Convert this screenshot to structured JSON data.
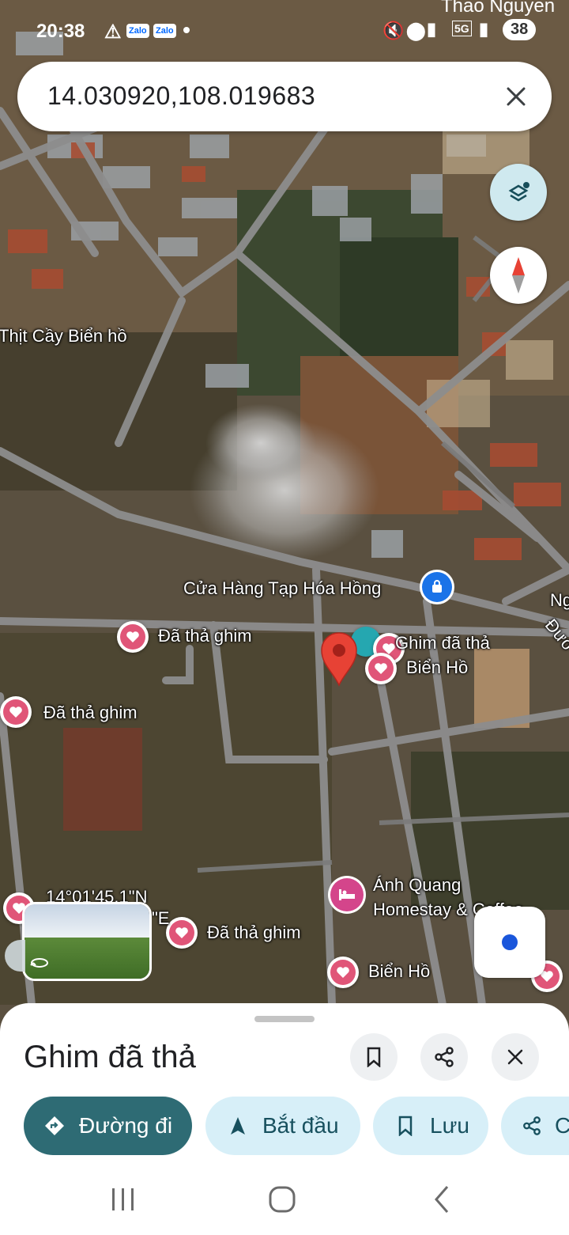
{
  "status_bar": {
    "time": "20:38",
    "app_badge_1": "Zalo",
    "app_badge_2": "Zalo",
    "network": "5G",
    "battery": "38",
    "overlay_name": "Thao Nguyen"
  },
  "search": {
    "query": "14.030920,108.019683"
  },
  "map": {
    "labels": {
      "thit_cay": "Thịt Cầy Biển hồ",
      "tap_hoa": "Cửa Hàng Tạp Hóa Hồng",
      "pin_1": "Đã thả ghim",
      "pin_2": "Đã thả ghim",
      "pin_3": "Đã thả ghim",
      "ghim_line1": "Ghim đã thả",
      "ghim_line2": "Biển Hồ",
      "anh_quang_line1": "Ánh Quang",
      "anh_quang_line2": "Homestay & Coffee",
      "bien_ho": "Biển Hồ",
      "coords_partial_1": "14°01'45.1\"N",
      "coords_partial_2": "\"E",
      "edge_1": "Ng",
      "edge_2": "Đườ"
    },
    "colors": {
      "pin": "#e74235",
      "heart": "#e05578",
      "location_dot": "#1a56db"
    }
  },
  "sheet": {
    "title": "Ghim đã thả",
    "chips": {
      "directions": "Đường đi",
      "start": "Bắt đầu",
      "save": "Lưu",
      "share": "C"
    }
  },
  "icons": {
    "search_clear": "close-icon",
    "layers": "layers-icon",
    "compass": "compass-icon",
    "my_location": "my-location-icon",
    "bookmark": "bookmark-icon",
    "share": "share-icon",
    "close": "close-icon"
  }
}
